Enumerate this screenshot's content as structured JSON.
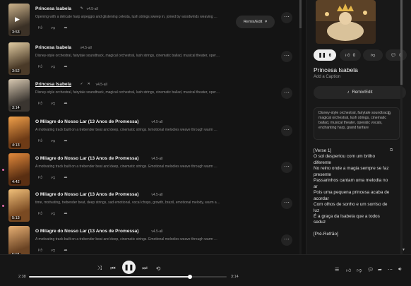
{
  "tracks": [
    {
      "title": "Princesa Isabela",
      "version": "v4.5-all",
      "duration": "3:53",
      "description": "Opening with a delicate harp arpeggio and glistening celesta, lush strings sweep in, joined by woodwinds weaving …",
      "playing": true
    },
    {
      "title": "Princesa Isabela",
      "version": "v4.5-all",
      "duration": "3:52",
      "description": "Disney-style orchestral, fairytale soundtrack, magical orchestral, lush strings, cinematic ballad, musical theater, oper…"
    },
    {
      "title": "Princesa Isabela",
      "version": "v4.5-all",
      "duration": "3:14",
      "description": "Disney-style orchestral, fairytale soundtrack, magical orchestral, lush strings, cinematic ballad, musical theater, oper…",
      "selected": true
    },
    {
      "title": "O Milagre do Nosso Lar (13 Anos de Promessa)",
      "version": "v4.5-all",
      "duration": "4:13",
      "description": "A motivating track built on a trebender beat and deep, cinematic strings. Emotional melodies weave through warm …"
    },
    {
      "title": "O Milagre do Nosso Lar (13 Anos de Promessa)",
      "version": "v4.5-all",
      "duration": "4:42",
      "description": "A motivating track built on a trebender beat and deep, cinematic strings. Emotional melodies weave through warm …"
    },
    {
      "title": "O Milagre do Nosso Lar (13 Anos de Promessa)",
      "version": "v4.5-all",
      "duration": "5:13",
      "description": "time, motivating, trebender beat, deep strings, sad emotional, vocal chops, growth, brazil, emotional melody, warm a…"
    },
    {
      "title": "O Milagre do Nosso Lar (13 Anos de Promessa)",
      "version": "v4.5-all",
      "duration": "5:04",
      "description": "A motivating track built on a trebender beat and deep, cinematic strings. Emotional melodies weave through warm …"
    }
  ],
  "remix_edit_label": "Remix/Edit",
  "panel": {
    "play_count": "6",
    "like_count": "0",
    "dislike_count": "",
    "comment_count": "0",
    "title": "Princesa Isabela",
    "caption": "Add a Caption",
    "remix_label": "Remix/Edit",
    "style": "Disney-style orchestral, fairytale soundtrack, magical orchestral, lush strings, cinematic ballad, musical theater, operatic vocals, enchanting harp, grand fanfare",
    "lyrics": [
      "[Verse 1]",
      "O sol despertou com um brilho",
      "diferente",
      "No reino onde a magia sempre se faz",
      "presente",
      "Passarinhos cantam uma melodia no",
      "ar",
      "Pois uma pequena princesa acaba de",
      "acordar",
      "Com olhos de sonho e um sorriso de",
      "luz",
      "É a graça da Isabela que a todos",
      "seduz",
      "",
      "[Pré-Refrão]"
    ]
  },
  "player": {
    "current_time": "2:38",
    "total_time": "3:14",
    "progress": 0.816
  },
  "colors": {
    "accent_dot": "#e36aa9",
    "background": "#141414"
  }
}
